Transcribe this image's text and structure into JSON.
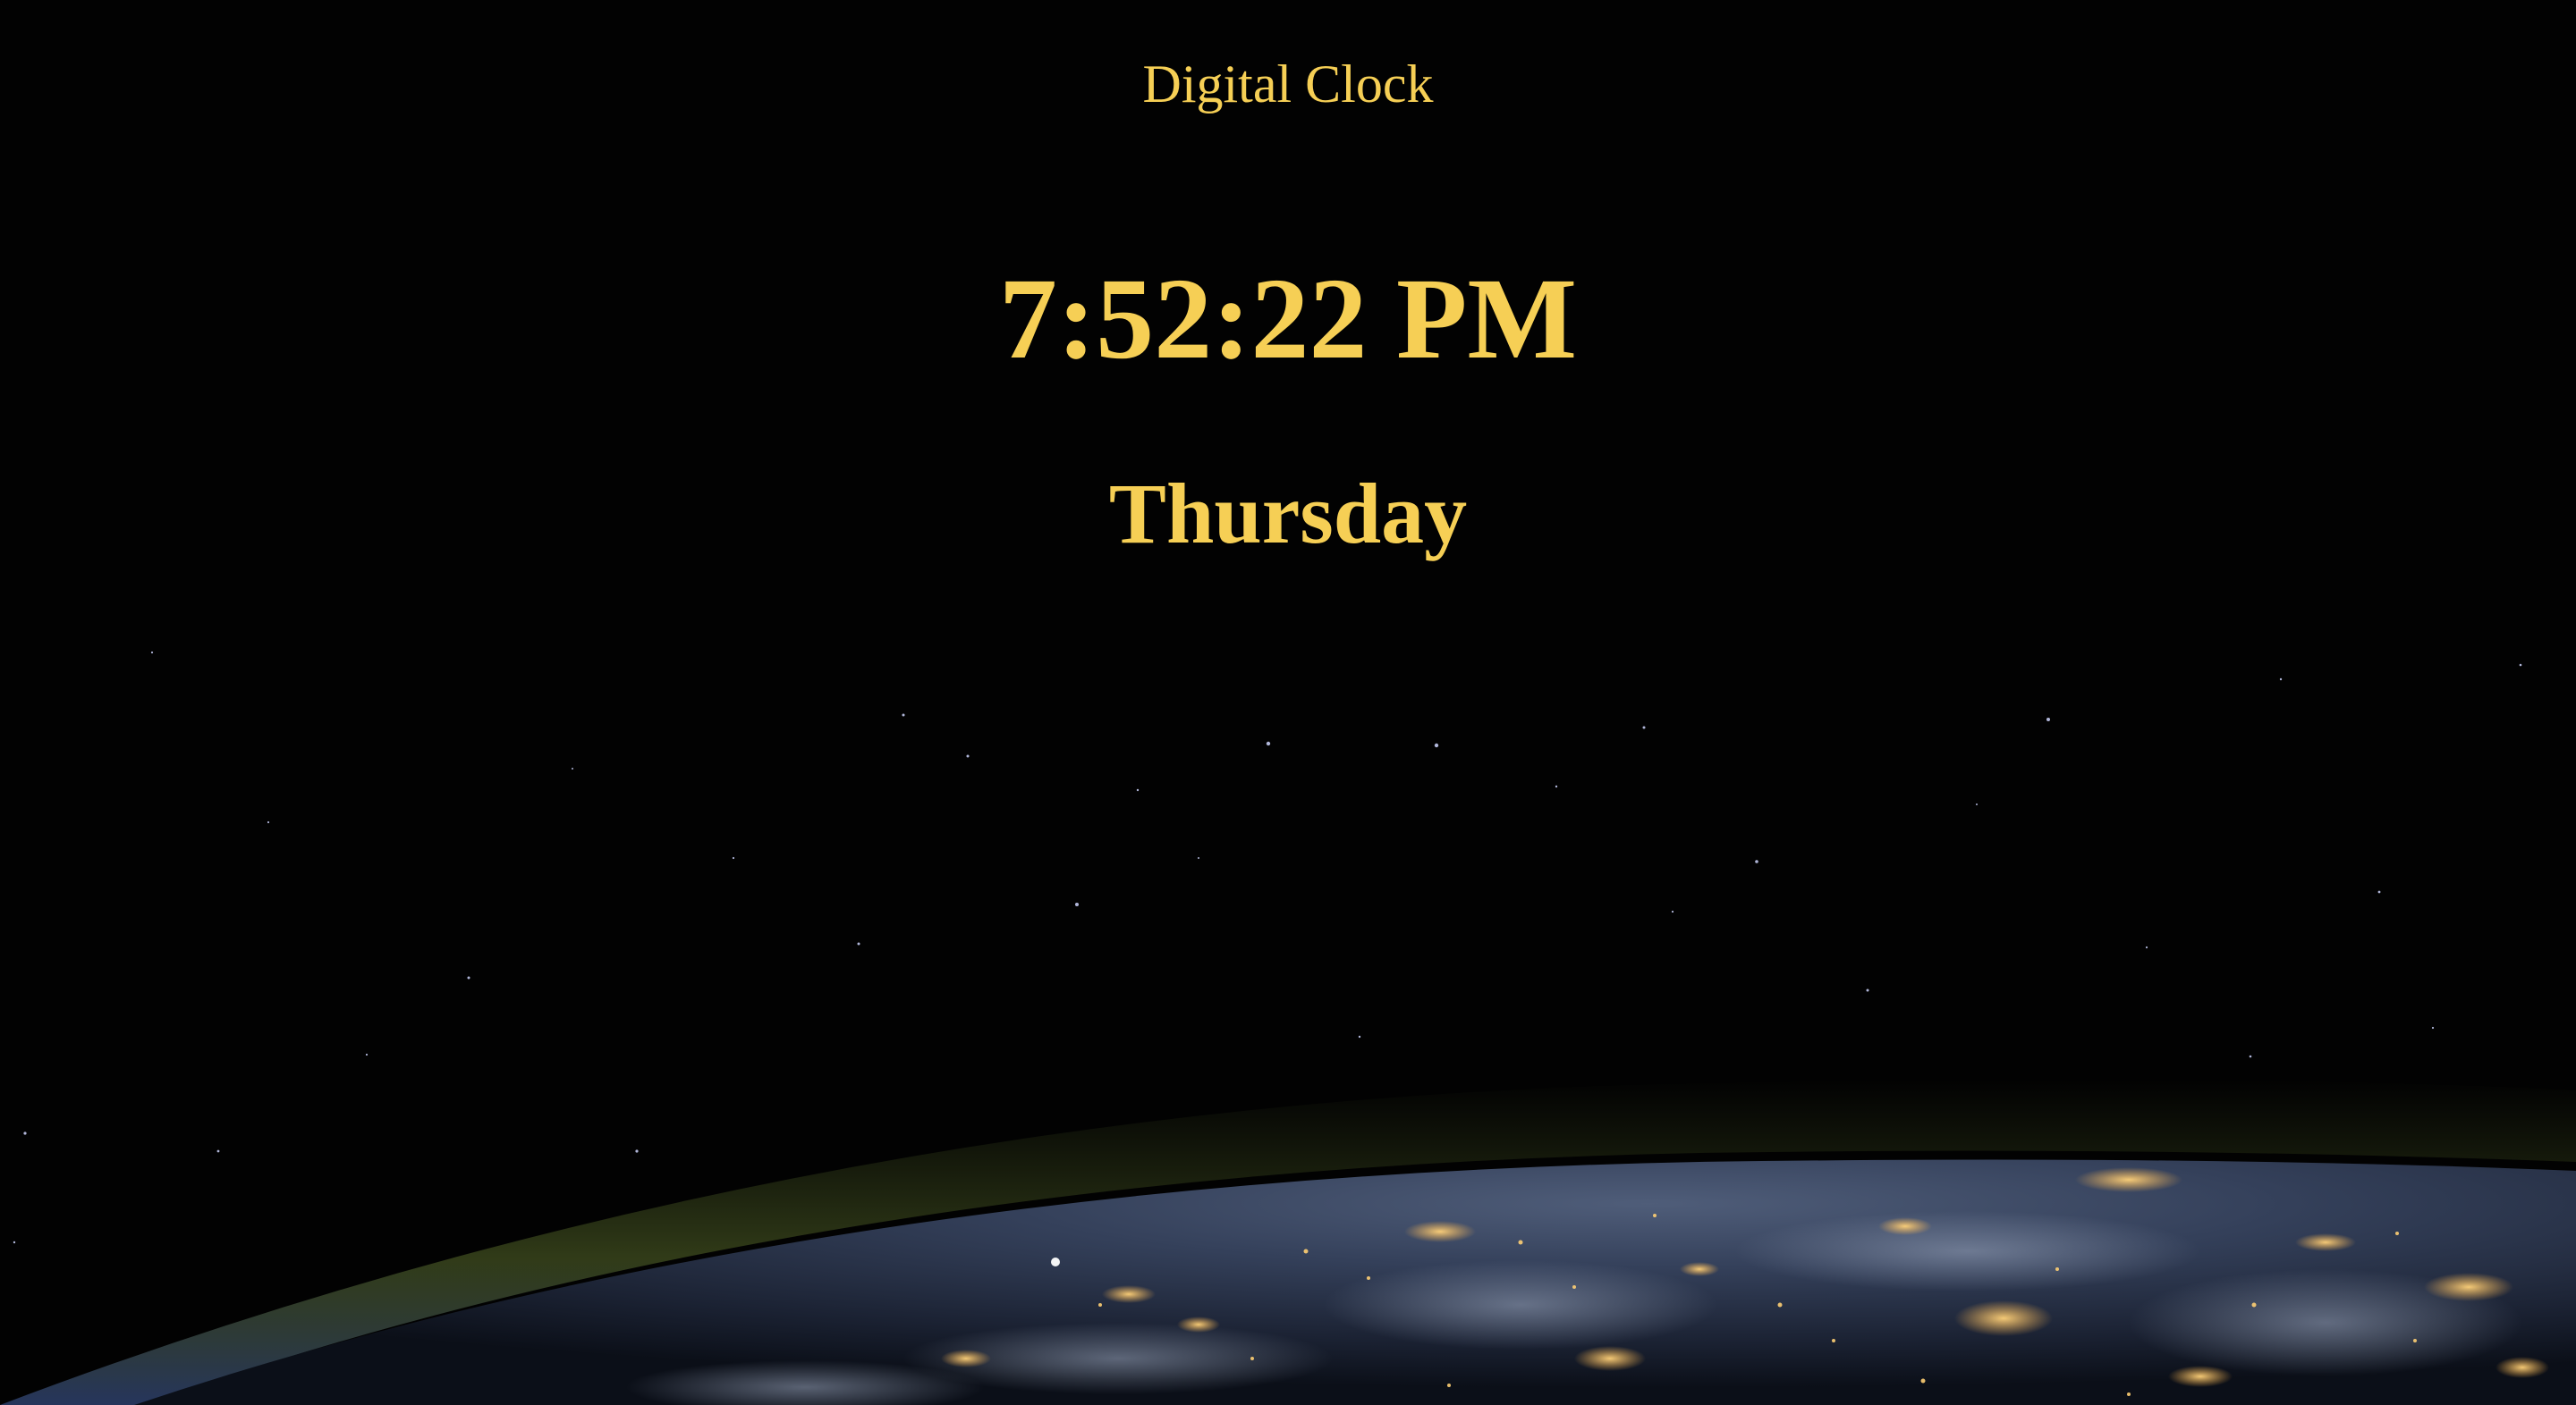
{
  "clock": {
    "title": "Digital Clock",
    "time": "7:52:22 PM",
    "day": "Thursday"
  },
  "background": {
    "scene": "earth-at-night-from-orbit",
    "accent": "#f6cf55",
    "sky": "#020202"
  }
}
